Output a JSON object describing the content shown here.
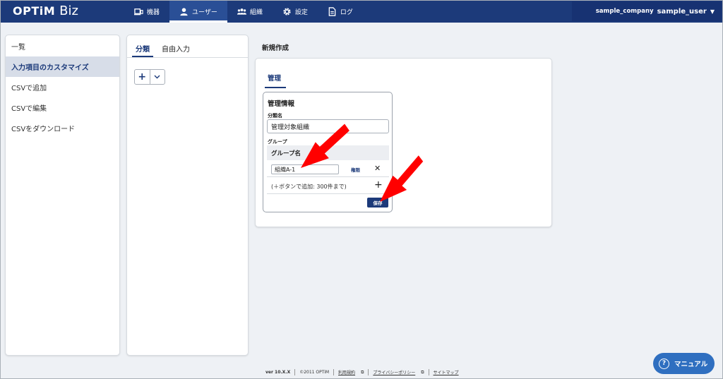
{
  "header": {
    "logo_main": "OPTiM",
    "logo_sub": "Biz",
    "nav": [
      {
        "label": "機器",
        "icon": "device-icon"
      },
      {
        "label": "ユーザー",
        "icon": "user-icon",
        "active": true
      },
      {
        "label": "組織",
        "icon": "organization-icon"
      },
      {
        "label": "設定",
        "icon": "gear-icon"
      },
      {
        "label": "ログ",
        "icon": "document-icon"
      }
    ],
    "company": "sample_company",
    "user": "sample_user"
  },
  "sidebar": {
    "items": [
      {
        "label": "一覧"
      },
      {
        "label": "入力項目のカスタマイズ",
        "active": true
      },
      {
        "label": "CSVで追加"
      },
      {
        "label": "CSVで編集"
      },
      {
        "label": "CSVをダウンロード"
      }
    ]
  },
  "middle": {
    "tabs": [
      {
        "label": "分類",
        "active": true
      },
      {
        "label": "自由入力"
      }
    ],
    "add_label": "+"
  },
  "main": {
    "title": "新規作成",
    "tab": "管理",
    "card": {
      "title": "管理情報",
      "category_label": "分類名",
      "category_value": "管理対象組織",
      "group_label": "グループ",
      "group_col": "グループ名",
      "group_value": "組織A-1",
      "perm_link": "権限",
      "add_hint": "(＋ボタンで追加: 300件まで)",
      "save": "保存"
    }
  },
  "footer": {
    "version": "ver 10.X.X",
    "copyright": "©2011 OPTiM",
    "terms": "利用規約",
    "privacy": "プライバシーポリシー",
    "sitemap": "サイトマップ"
  },
  "manual_button": "マニュアル",
  "colors": {
    "header_bg": "#1c3a7a",
    "accent": "#1c3a7a",
    "annotation_arrow": "#ff0000"
  }
}
